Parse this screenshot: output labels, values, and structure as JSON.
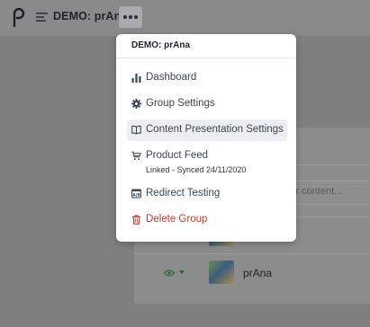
{
  "header": {
    "group_title": "DEMO: prAna",
    "logo_letter": "p"
  },
  "dropdown": {
    "header": "DEMO: prAna",
    "items": [
      {
        "label": "Dashboard",
        "icon": "bar-chart-icon"
      },
      {
        "label": "Group Settings",
        "icon": "gear-icon"
      },
      {
        "label": "Content Presentation Settings",
        "icon": "book-open-icon",
        "active": true
      },
      {
        "label": "Product Feed",
        "icon": "cart-icon",
        "sublabel": "Linked - Synced 24/11/2020"
      },
      {
        "label": "Redirect Testing",
        "icon": "ab-test-icon"
      },
      {
        "label": "Delete Group",
        "icon": "trash-icon",
        "danger": true
      }
    ]
  },
  "background": {
    "search_placeholder": "h for content...",
    "row_title": "prAna"
  },
  "colors": {
    "danger": "#d8342a",
    "active_bg": "#eceef1",
    "overlay": "#7f7f7f"
  }
}
